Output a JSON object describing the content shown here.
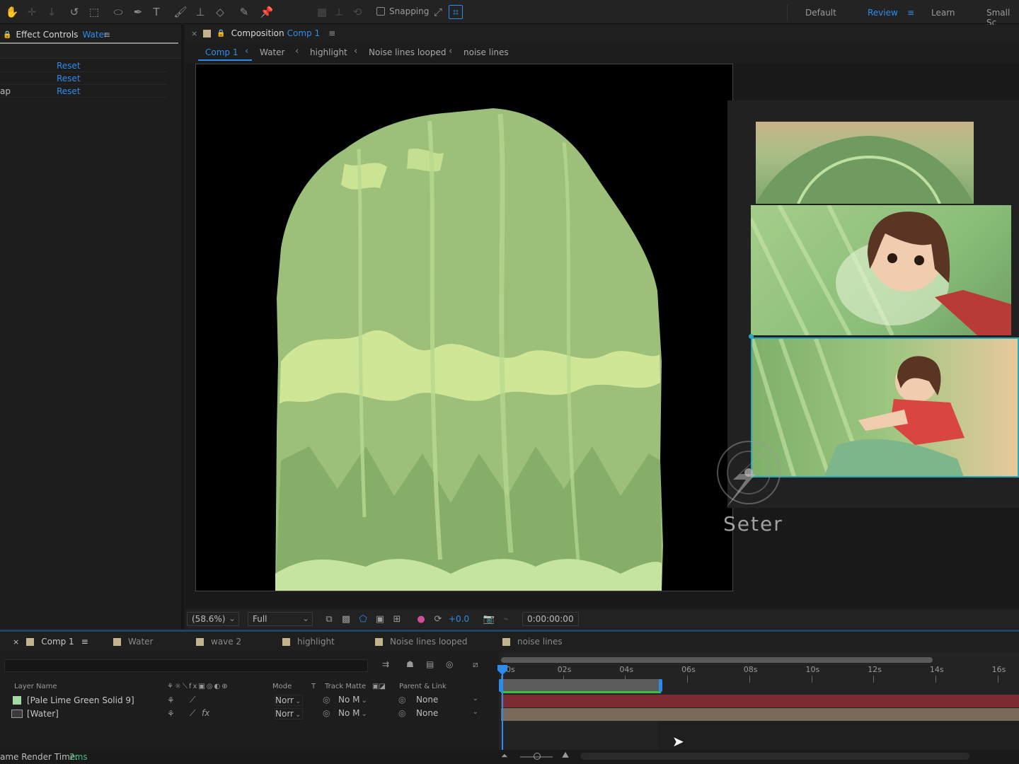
{
  "toolbar": {
    "snapping_label": "Snapping",
    "workspaces": [
      "Default",
      "Review",
      "Learn",
      "Small Sc"
    ]
  },
  "effect_controls": {
    "title": "Effect Controls",
    "layer": "Water",
    "rows": [
      {
        "label": "",
        "reset": "Reset"
      },
      {
        "label": "",
        "reset": "Reset"
      },
      {
        "label": "ap",
        "reset": "Reset"
      }
    ]
  },
  "composition": {
    "title": "Composition",
    "name": "Comp 1",
    "breadcrumbs": [
      "Comp 1",
      "Water",
      "highlight",
      "Noise lines looped",
      "noise lines"
    ]
  },
  "watermark": {
    "text": "Seter"
  },
  "viewer_footer": {
    "zoom": "(58.6%)",
    "resolution": "Full",
    "exposure": "+0.0",
    "timecode": "0:00:00:00"
  },
  "timeline": {
    "tabs": [
      "Comp 1",
      "Water",
      "wave 2",
      "highlight",
      "Noise lines looped",
      "noise lines"
    ],
    "columns": {
      "layer_name": "Layer Name",
      "mode": "Mode",
      "t": "T",
      "track_matte": "Track Matte",
      "parent": "Parent & Link"
    },
    "layers": [
      {
        "name": "[Pale Lime Green Solid 9]",
        "mode": "Norr",
        "matte": "No M",
        "parent": "None",
        "color": "#a3d9a5"
      },
      {
        "name": "[Water]",
        "mode": "Norr",
        "matte": "No M",
        "parent": "None",
        "color": "#7a7a7a"
      }
    ],
    "ruler": [
      "00s",
      "02s",
      "04s",
      "06s",
      "08s",
      "10s",
      "12s",
      "14s",
      "16s"
    ]
  },
  "status": {
    "label": "ame Render Time:",
    "value": "2ms"
  },
  "colors": {
    "accent": "#2d8ceb",
    "water_green": "#9cc07a",
    "layer_red": "#7c2b33",
    "layer_tan": "#7a6a5a"
  }
}
